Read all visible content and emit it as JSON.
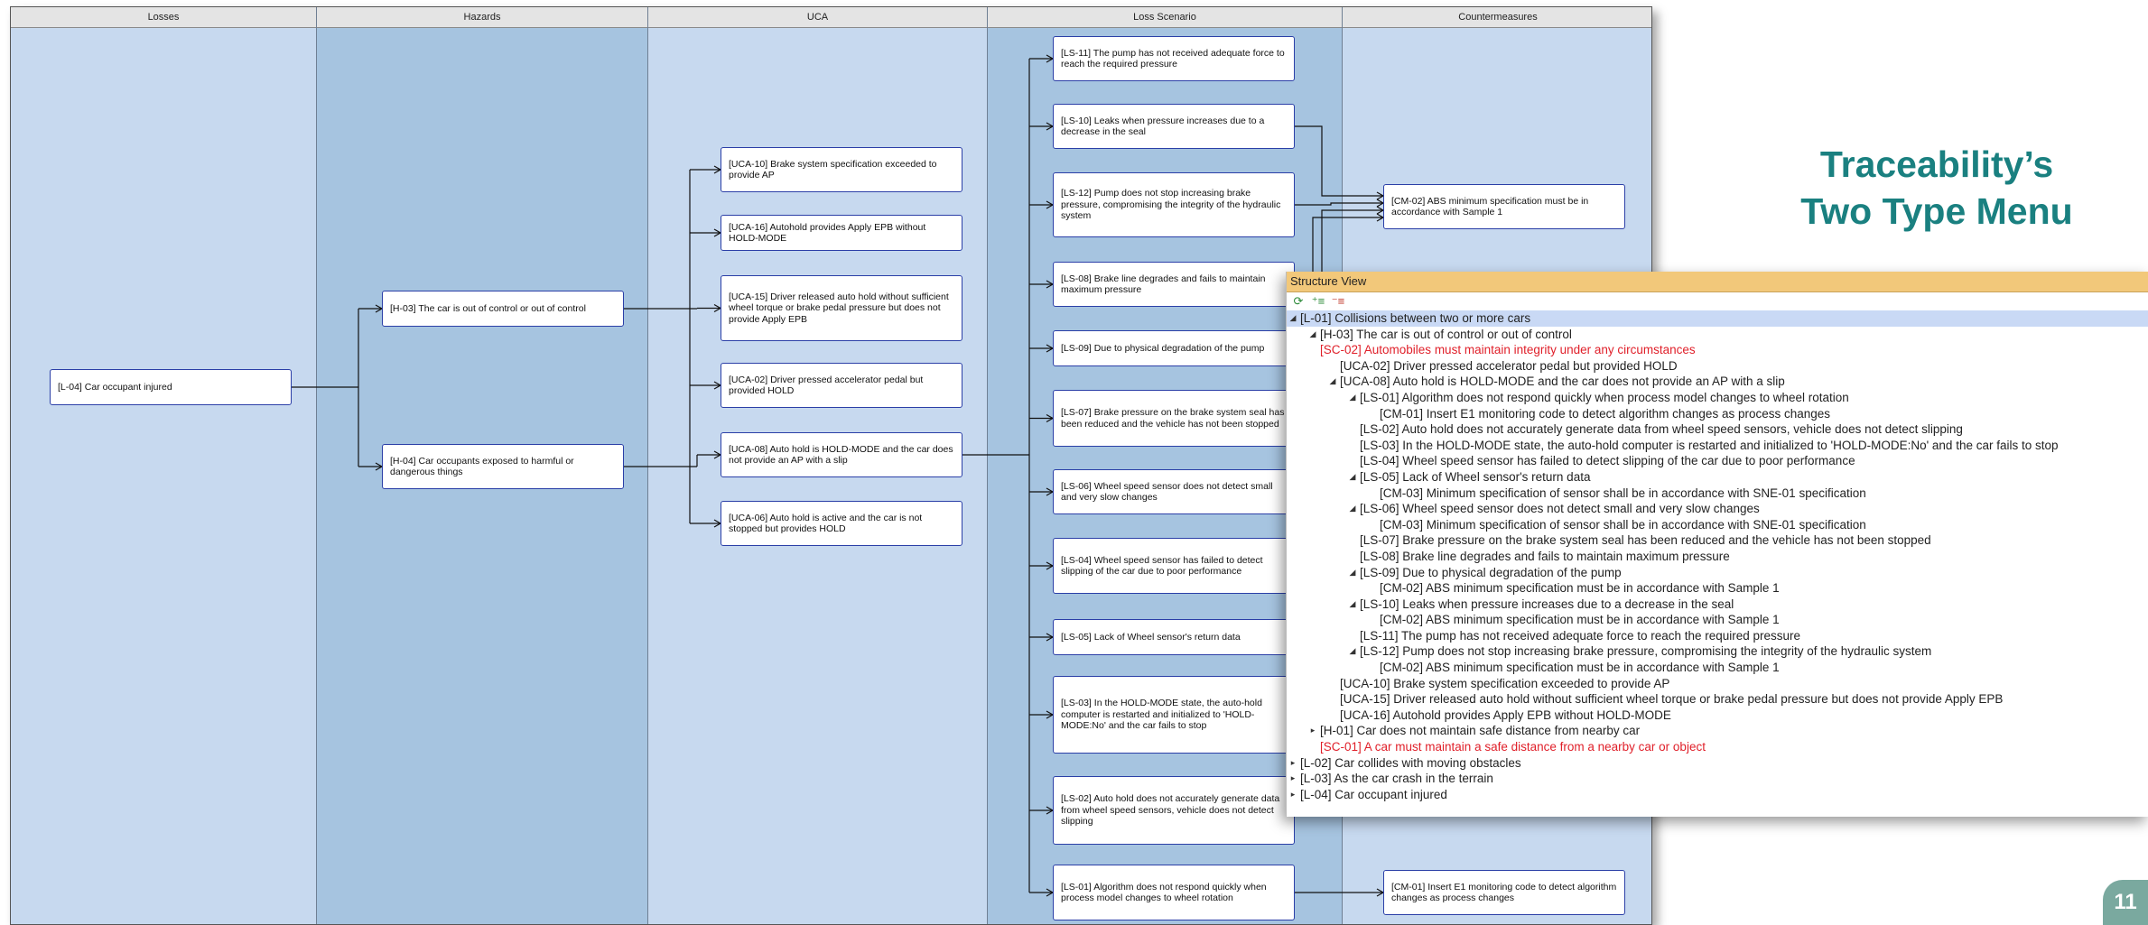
{
  "slide": {
    "title_line1": "Traceability’s",
    "title_line2": "Two Type Menu",
    "page_number": "11"
  },
  "diagram": {
    "columns": [
      "Losses",
      "Hazards",
      "UCA",
      "Loss Scenario",
      "Countermeasures"
    ],
    "nodes": {
      "l04": "[L-04] Car occupant injured",
      "h03": "[H-03] The car is out of control or out of control",
      "h04": "[H-04] Car occupants exposed to harmful or dangerous things",
      "uca10": "[UCA-10] Brake system specification exceeded to provide AP",
      "uca16": "[UCA-16] Autohold provides Apply EPB without HOLD-MODE",
      "uca15": "[UCA-15] Driver released auto hold without sufficient wheel torque or brake pedal pressure but does not provide Apply EPB",
      "uca02": "[UCA-02] Driver pressed accelerator pedal but provided HOLD",
      "uca08": "[UCA-08] Auto hold is HOLD-MODE and the car does not provide an AP with a slip",
      "uca06": "[UCA-06] Auto hold is active and the car is not stopped but provides HOLD",
      "ls11": "[LS-11] The pump has not received adequate force to reach the required pressure",
      "ls10": "[LS-10] Leaks when pressure increases due to a decrease in the seal",
      "ls12": "[LS-12] Pump does not stop increasing brake pressure, compromising the integrity of the hydraulic system",
      "ls08": "[LS-08] Brake line degrades and fails to maintain maximum pressure",
      "ls09": "[LS-09] Due to physical degradation of the pump",
      "ls07": "[LS-07] Brake pressure on the brake system seal has been reduced and the vehicle has not been stopped",
      "ls06": "[LS-06] Wheel speed sensor does not detect small and very slow changes",
      "ls04": "[LS-04] Wheel speed sensor has failed to detect slipping of the car due to poor performance",
      "ls05": "[LS-05] Lack of Wheel sensor's return data",
      "ls03": "[LS-03] In the HOLD-MODE state, the auto-hold computer is restarted and initialized to 'HOLD-MODE:No' and the car fails to stop",
      "ls02": "[LS-02] Auto hold does not accurately generate data from wheel speed sensors, vehicle does not detect slipping",
      "ls01": "[LS-01] Algorithm does not respond quickly when process model changes to wheel rotation",
      "cm02": "[CM-02] ABS minimum specification must be in accordance with Sample 1",
      "cm01": "[CM-01] Insert E1 monitoring code to detect algorithm changes as process changes"
    }
  },
  "structure_view": {
    "title": "Structure View",
    "toolbar": [
      "refresh-icon",
      "expand-all-icon",
      "collapse-all-icon"
    ],
    "rows": [
      {
        "text": "[L-01] Collisions between two or more cars",
        "level": 0,
        "toggle": "open",
        "color": "normal",
        "selected": true
      },
      {
        "text": "[H-03] The car is out of control or out of control",
        "level": 1,
        "toggle": "open",
        "color": "normal"
      },
      {
        "text": "[SC-02] Automobiles must maintain integrity under any circumstances",
        "level": 1,
        "toggle": "",
        "color": "red"
      },
      {
        "text": "[UCA-02] Driver pressed accelerator pedal but provided HOLD",
        "level": 2,
        "toggle": "",
        "color": "normal"
      },
      {
        "text": "[UCA-08] Auto hold is HOLD-MODE and the car does not provide an AP with a slip",
        "level": 2,
        "toggle": "open",
        "color": "normal"
      },
      {
        "text": "[LS-01] Algorithm does not respond quickly when process model changes to wheel rotation",
        "level": 3,
        "toggle": "open",
        "color": "normal"
      },
      {
        "text": "[CM-01] Insert E1 monitoring code to detect algorithm changes as process changes",
        "level": 4,
        "toggle": "",
        "color": "normal"
      },
      {
        "text": "[LS-02] Auto hold does not accurately generate data from wheel speed sensors, vehicle does not detect slipping",
        "level": 3,
        "toggle": "",
        "color": "normal"
      },
      {
        "text": "[LS-03] In the HOLD-MODE state, the auto-hold computer is restarted and initialized to 'HOLD-MODE:No' and the car fails to stop",
        "level": 3,
        "toggle": "",
        "color": "normal"
      },
      {
        "text": "[LS-04] Wheel speed sensor has failed to detect slipping of the car due to poor performance",
        "level": 3,
        "toggle": "",
        "color": "normal"
      },
      {
        "text": "[LS-05] Lack of Wheel sensor's return data",
        "level": 3,
        "toggle": "open",
        "color": "normal"
      },
      {
        "text": "[CM-03] Minimum specification of sensor shall be in accordance with SNE-01 specification",
        "level": 4,
        "toggle": "",
        "color": "normal"
      },
      {
        "text": "[LS-06] Wheel speed sensor does not detect small and very slow changes",
        "level": 3,
        "toggle": "open",
        "color": "normal"
      },
      {
        "text": "[CM-03] Minimum specification of sensor shall be in accordance with SNE-01 specification",
        "level": 4,
        "toggle": "",
        "color": "normal"
      },
      {
        "text": "[LS-07] Brake pressure on the brake system seal has been reduced and the vehicle has not been stopped",
        "level": 3,
        "toggle": "",
        "color": "normal"
      },
      {
        "text": "[LS-08] Brake line degrades and fails to maintain maximum pressure",
        "level": 3,
        "toggle": "",
        "color": "normal"
      },
      {
        "text": "[LS-09] Due to physical degradation of the pump",
        "level": 3,
        "toggle": "open",
        "color": "normal"
      },
      {
        "text": "[CM-02] ABS minimum specification must be in accordance with Sample 1",
        "level": 4,
        "toggle": "",
        "color": "normal"
      },
      {
        "text": "[LS-10] Leaks when pressure increases due to a decrease in the seal",
        "level": 3,
        "toggle": "open",
        "color": "normal"
      },
      {
        "text": "[CM-02] ABS minimum specification must be in accordance with Sample 1",
        "level": 4,
        "toggle": "",
        "color": "normal"
      },
      {
        "text": "[LS-11] The pump has not received adequate force to reach the required pressure",
        "level": 3,
        "toggle": "",
        "color": "normal"
      },
      {
        "text": "[LS-12] Pump does not stop increasing brake pressure, compromising the integrity of the hydraulic system",
        "level": 3,
        "toggle": "open",
        "color": "normal"
      },
      {
        "text": "[CM-02] ABS minimum specification must be in accordance with Sample 1",
        "level": 4,
        "toggle": "",
        "color": "normal"
      },
      {
        "text": "[UCA-10] Brake system specification exceeded to provide AP",
        "level": 2,
        "toggle": "",
        "color": "normal"
      },
      {
        "text": "[UCA-15] Driver released auto hold without sufficient wheel torque or brake pedal pressure but does not provide Apply EPB",
        "level": 2,
        "toggle": "",
        "color": "normal"
      },
      {
        "text": "[UCA-16] Autohold provides Apply EPB without HOLD-MODE",
        "level": 2,
        "toggle": "",
        "color": "normal"
      },
      {
        "text": "[H-01] Car does not maintain safe distance from nearby car",
        "level": 1,
        "toggle": "closed",
        "color": "normal"
      },
      {
        "text": "[SC-01] A car must maintain a safe distance from a nearby car or object",
        "level": 1,
        "toggle": "",
        "color": "red"
      },
      {
        "text": "[L-02] Car collides with moving obstacles",
        "level": 0,
        "toggle": "closed",
        "color": "normal"
      },
      {
        "text": "[L-03] As the car crash in the terrain",
        "level": 0,
        "toggle": "closed",
        "color": "normal"
      },
      {
        "text": "[L-04] Car occupant injured",
        "level": 0,
        "toggle": "closed",
        "color": "normal"
      }
    ]
  },
  "colors": {
    "col_light": "#c7d9ef",
    "col_dark": "#a6c4e0",
    "node_border": "#2b3fa7",
    "title": "#1a8080",
    "titlebar": "#f2c87a",
    "selected": "#c9d9f5",
    "red": "#e0202a"
  }
}
